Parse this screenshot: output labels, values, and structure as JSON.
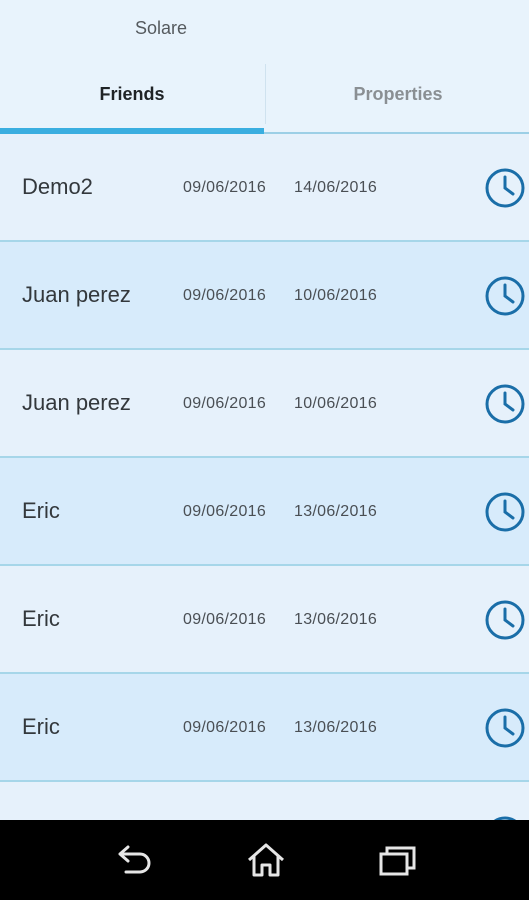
{
  "app": {
    "title": "Solare"
  },
  "tabs": [
    {
      "label": "Friends",
      "active": true
    },
    {
      "label": "Properties",
      "active": false
    }
  ],
  "rows": [
    {
      "name": "Demo2",
      "start": "09/06/2016",
      "end": "14/06/2016",
      "icon": "clock-icon"
    },
    {
      "name": "Juan perez",
      "start": "09/06/2016",
      "end": "10/06/2016",
      "icon": "clock-icon"
    },
    {
      "name": "Juan perez",
      "start": "09/06/2016",
      "end": "10/06/2016",
      "icon": "clock-icon"
    },
    {
      "name": "Eric",
      "start": "09/06/2016",
      "end": "13/06/2016",
      "icon": "clock-icon"
    },
    {
      "name": "Eric",
      "start": "09/06/2016",
      "end": "13/06/2016",
      "icon": "clock-icon"
    },
    {
      "name": "Eric",
      "start": "09/06/2016",
      "end": "13/06/2016",
      "icon": "clock-icon"
    }
  ],
  "colors": {
    "accent": "#3aaee0",
    "icon": "#1a6ea8",
    "divider": "#a6d6e9"
  },
  "navbar": {
    "buttons": [
      "back-icon",
      "home-icon",
      "recent-apps-icon"
    ]
  }
}
